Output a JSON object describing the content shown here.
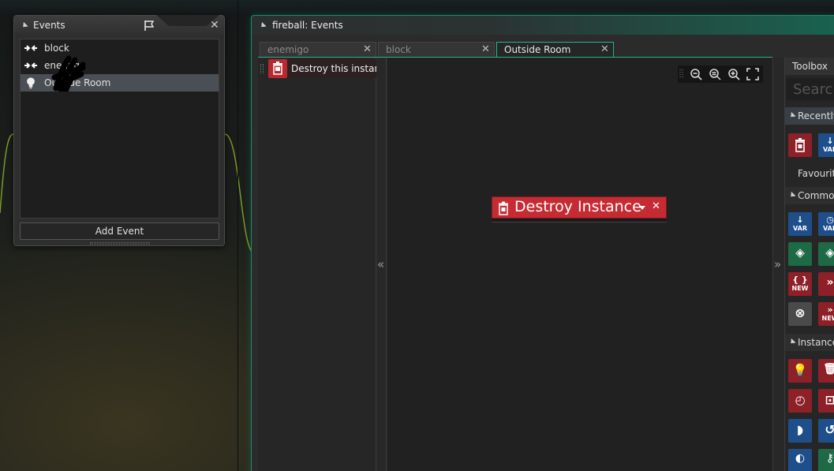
{
  "events_panel": {
    "title": "Events",
    "items": [
      {
        "label": "block",
        "icon": "collision-icon"
      },
      {
        "label": "enemigo",
        "icon": "collision-icon"
      },
      {
        "label": "Outside Room",
        "icon": "lightbulb-icon",
        "selected": true
      }
    ],
    "add_event_label": "Add Event"
  },
  "main_window": {
    "title": "fireball: Events",
    "tabs": [
      {
        "label": "enemigo",
        "active": false
      },
      {
        "label": "block",
        "active": false
      },
      {
        "label": "Outside Room",
        "active": true
      }
    ],
    "action_list": [
      {
        "label": "Destroy this instance",
        "icon": "trash-icon"
      }
    ],
    "node": {
      "label": "Destroy Instance",
      "icon": "trash-icon"
    },
    "collapse_left": "«",
    "collapse_right": "»"
  },
  "toolbox": {
    "title": "Toolbox",
    "search_placeholder": "Search",
    "sections": [
      "Recently",
      "Favourite",
      "Common",
      "Instance"
    ],
    "var_label": "VAR",
    "new_label": "NEW"
  },
  "colors": {
    "accent": "#27b48b",
    "action_red": "#c62b33",
    "selected": "#4a4e55"
  }
}
